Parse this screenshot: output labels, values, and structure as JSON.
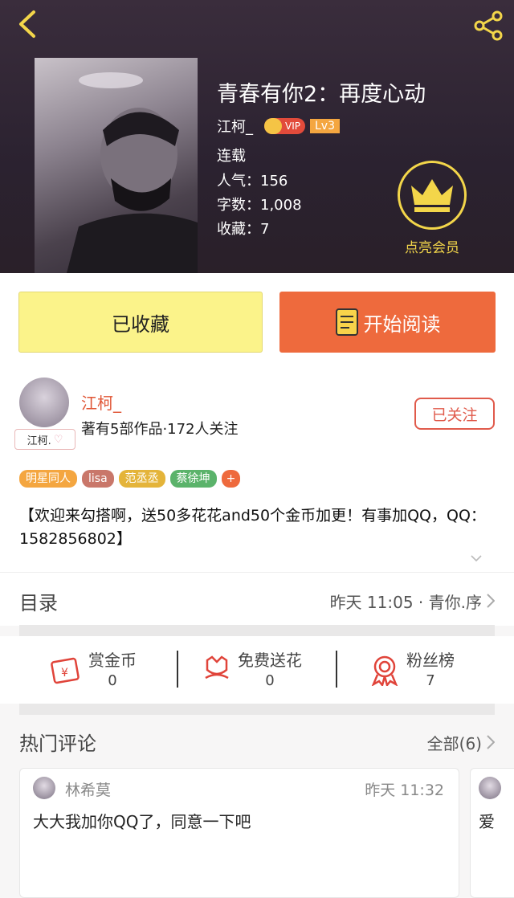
{
  "book": {
    "title": "青春有你2：再度心动",
    "author": "江柯_",
    "vip": "VIP",
    "level": "Lv3",
    "status": "连载",
    "popularity": "人气：156",
    "words": "字数：1,008",
    "favorites": "收藏：7",
    "member_label": "点亮会员"
  },
  "actions": {
    "favorited_label": "已收藏",
    "read_label": "开始阅读"
  },
  "author": {
    "name": "江柯_",
    "stats": "著有5部作品·172人关注",
    "avatar_tag": "江柯.",
    "follow_label": "已关注"
  },
  "tags": [
    {
      "label": "明星同人",
      "color": "#f4a640"
    },
    {
      "label": "lisa",
      "color": "#c9776a"
    },
    {
      "label": "范丞丞",
      "color": "#e4b43a"
    },
    {
      "label": "蔡徐坤",
      "color": "#5bb36b"
    },
    {
      "label": "+",
      "color": "#ee6a3d"
    }
  ],
  "description": "【欢迎来勾搭啊，送50多花花and50个金币加更！有事加QQ，QQ：1582856802】",
  "toc": {
    "title": "目录",
    "latest": "昨天 11:05 · 青你.序"
  },
  "stats": {
    "coins_label": "赏金币",
    "coins_value": "0",
    "flowers_label": "免费送花",
    "flowers_value": "0",
    "fans_label": "粉丝榜",
    "fans_value": "7"
  },
  "comments": {
    "title": "热门评论",
    "all_label": "全部(6)",
    "items": [
      {
        "user": "林希莫",
        "time": "昨天 11:32",
        "text": "大大我加你QQ了，同意一下吧"
      },
      {
        "user": "",
        "time": "",
        "text": "爱"
      }
    ]
  },
  "colors": {
    "accent": "#ee6a3d",
    "favorite_bg": "#fbf38a",
    "gold": "#f3d64a"
  }
}
